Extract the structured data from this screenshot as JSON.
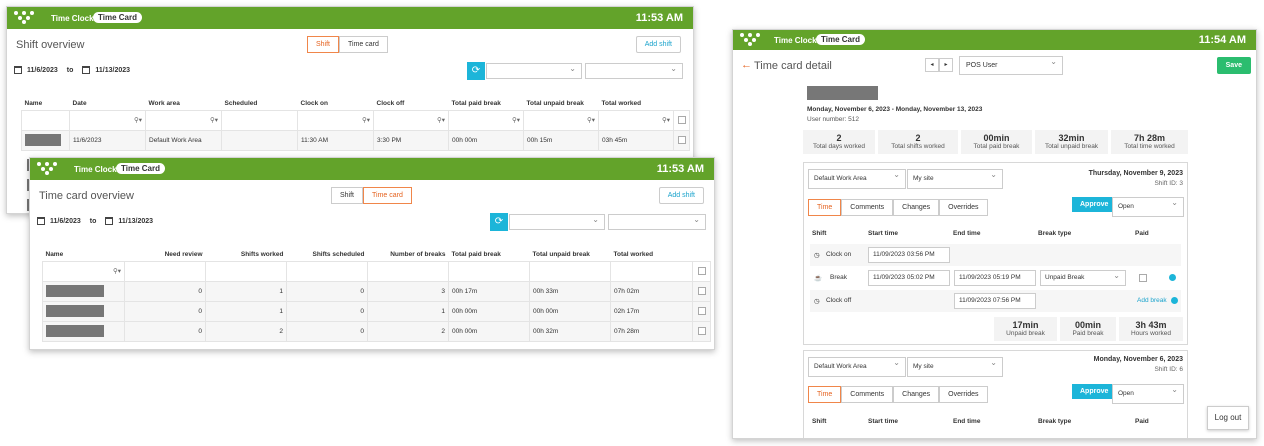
{
  "common": {
    "app_name": "Time Clock",
    "module_pill": "Time Card"
  },
  "shift_window": {
    "clock": "11:53 AM",
    "title": "Shift overview",
    "toggle": [
      "Shift",
      "Time card"
    ],
    "add_shift": "Add shift",
    "date_from": "11/6/2023",
    "date_to_word": "to",
    "date_to": "11/13/2023",
    "columns": [
      "Name",
      "Date",
      "Work area",
      "Scheduled",
      "Clock on",
      "Clock off",
      "Total paid break",
      "Total unpaid break",
      "Total worked"
    ],
    "rows": [
      {
        "date": "11/6/2023",
        "work_area": "Default Work Area",
        "scheduled": "",
        "clock_on": "11:30 AM",
        "clock_off": "3:30 PM",
        "paid_break": "00h 00m",
        "unpaid_break": "00h 15m",
        "worked": "03h 45m"
      }
    ]
  },
  "timecard_window": {
    "clock": "11:53 AM",
    "title": "Time card overview",
    "toggle": [
      "Shift",
      "Time card"
    ],
    "add_shift": "Add shift",
    "date_from": "11/6/2023",
    "date_to_word": "to",
    "date_to": "11/13/2023",
    "columns": [
      "Name",
      "Need review",
      "Shifts worked",
      "Shifts scheduled",
      "Number of breaks",
      "Total paid break",
      "Total unpaid break",
      "Total worked"
    ],
    "rows": [
      {
        "need_review": "0",
        "shifts_worked": "1",
        "shifts_scheduled": "0",
        "breaks": "3",
        "paid_break": "00h 17m",
        "unpaid_break": "00h 33m",
        "worked": "07h 02m"
      },
      {
        "need_review": "0",
        "shifts_worked": "1",
        "shifts_scheduled": "0",
        "breaks": "1",
        "paid_break": "00h 00m",
        "unpaid_break": "00h 00m",
        "worked": "02h 17m"
      },
      {
        "need_review": "0",
        "shifts_worked": "2",
        "shifts_scheduled": "0",
        "breaks": "2",
        "paid_break": "00h 00m",
        "unpaid_break": "00h 32m",
        "worked": "07h 28m"
      }
    ]
  },
  "detail_window": {
    "clock": "11:54 AM",
    "title": "Time card detail",
    "user_select": "POS User",
    "save": "Save",
    "date_range": "Monday, November 6, 2023 - Monday, November 13, 2023",
    "user_number": "User number: 512",
    "summary": [
      {
        "value": "2",
        "label": "Total days worked"
      },
      {
        "value": "2",
        "label": "Total shifts worked"
      },
      {
        "value": "00min",
        "label": "Total paid break"
      },
      {
        "value": "32min",
        "label": "Total unpaid break"
      },
      {
        "value": "7h 28m",
        "label": "Total time worked"
      }
    ],
    "card1": {
      "work_area": "Default Work Area",
      "site": "My site",
      "date": "Thursday, November 9, 2023",
      "shift_id": "Shift ID: 3",
      "tabs": [
        "Time",
        "Comments",
        "Changes",
        "Overrides"
      ],
      "approve": "Approve",
      "status": "Open",
      "headers": [
        "Shift",
        "Start time",
        "End time",
        "Break type",
        "Paid"
      ],
      "clock_on_label": "Clock on",
      "clock_on_time": "11/09/2023 03:56 PM",
      "break_label": "Break",
      "break_start": "11/09/2023 05:02 PM",
      "break_end": "11/09/2023 05:19 PM",
      "break_type": "Unpaid Break",
      "clock_off_label": "Clock off",
      "clock_off_time": "11/09/2023 07:56 PM",
      "add_break": "Add break",
      "totals": [
        {
          "value": "17min",
          "label": "Unpaid break"
        },
        {
          "value": "00min",
          "label": "Paid break"
        },
        {
          "value": "3h 43m",
          "label": "Hours worked"
        }
      ]
    },
    "card2": {
      "work_area": "Default Work Area",
      "site": "My site",
      "date": "Monday, November 6, 2023",
      "shift_id": "Shift ID: 6",
      "tabs": [
        "Time",
        "Comments",
        "Changes",
        "Overrides"
      ],
      "approve": "Approve",
      "status": "Open",
      "headers": [
        "Shift",
        "Start time",
        "End time",
        "Break type",
        "Paid"
      ]
    },
    "logout": "Log out"
  },
  "colors": {
    "topbar": "#63a32a",
    "accent_orange": "#e5621f",
    "accent_blue": "#1cb5d9"
  },
  "icons": [
    "logo-icon",
    "calendar-icon",
    "refresh-icon",
    "filter-icon",
    "clock-icon",
    "coffee-icon",
    "arrow-left-icon",
    "chevron-down-icon"
  ]
}
